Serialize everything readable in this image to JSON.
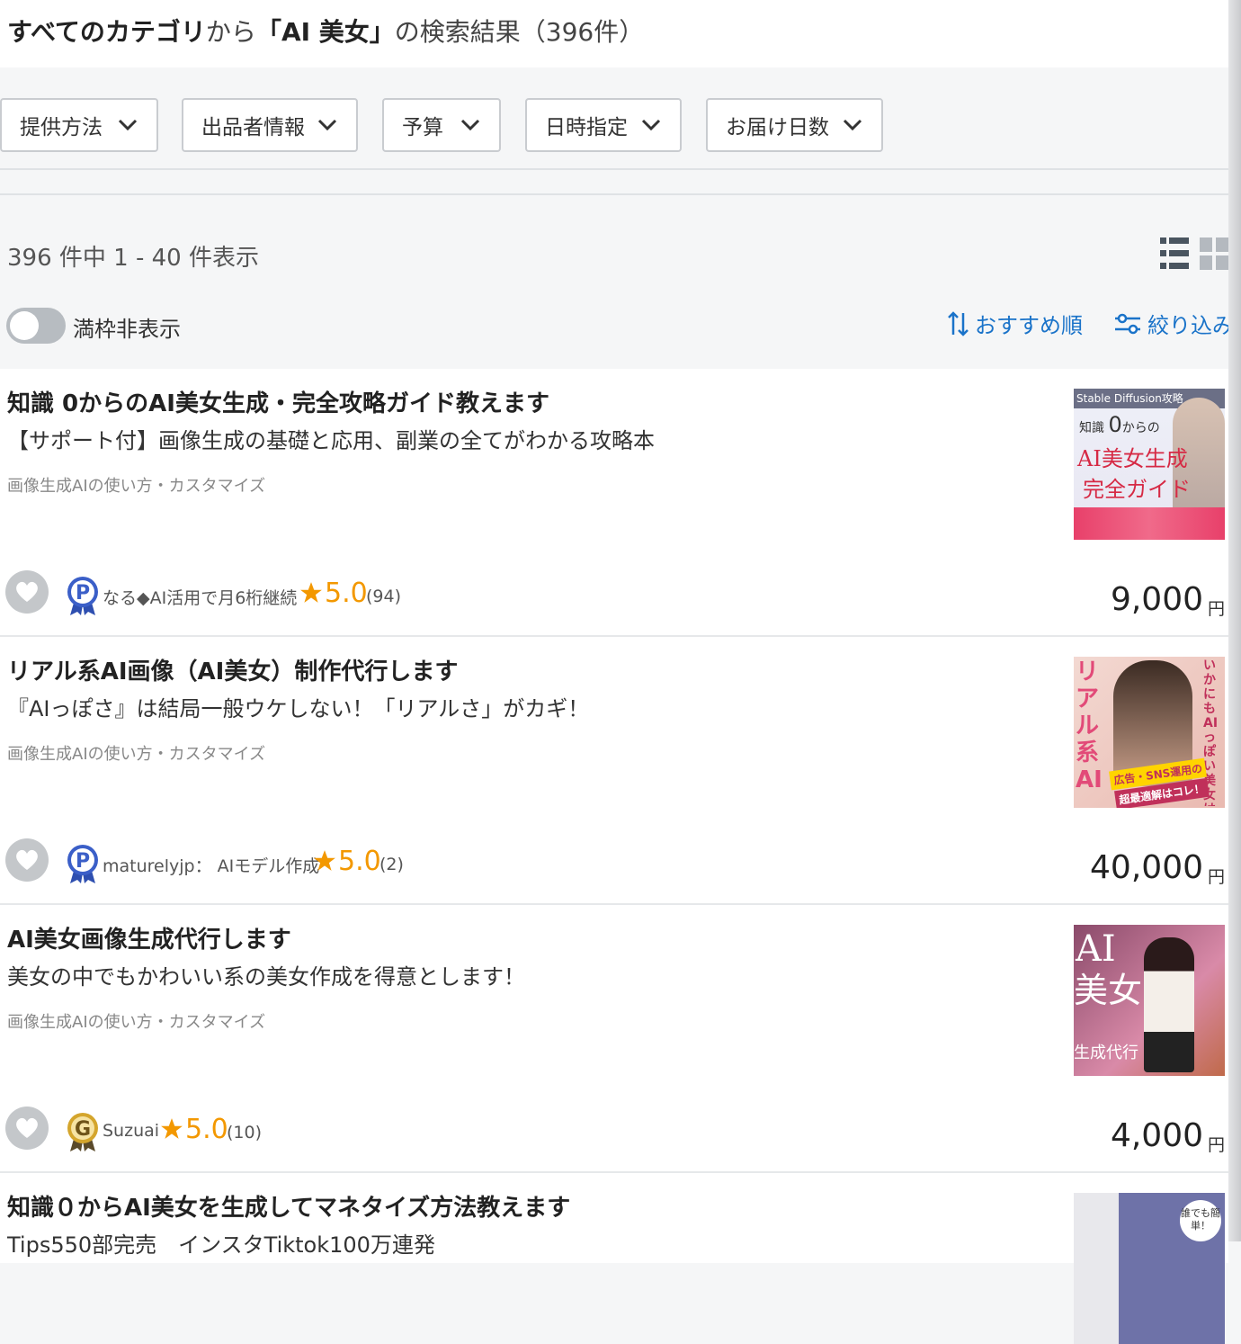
{
  "header": {
    "category": "すべてのカテゴリ",
    "from": "から",
    "query": "「AI 美女」",
    "suffix": "の検索結果",
    "count": "（396件）"
  },
  "filters": [
    {
      "label": "提供方法"
    },
    {
      "label": "出品者情報"
    },
    {
      "label": "予算"
    },
    {
      "label": "日時指定"
    },
    {
      "label": "お届け日数"
    }
  ],
  "results_summary": "396 件中 1 - 40 件表示",
  "toggle": {
    "label": "満枠非表示",
    "on": false
  },
  "sort": {
    "label": "おすすめ順"
  },
  "filter_link": {
    "label": "絞り込み"
  },
  "accent_color": "#1a73c9",
  "rating_color": "#f39800",
  "listings": [
    {
      "title": "知識 0からのAI美女生成・完全攻略ガイド教えます",
      "subtitle": "【サポート付】画像生成の基礎と応用、副業の全てがわかる攻略本",
      "category": "画像生成AIの使い方・カスタマイズ",
      "badge": "P",
      "seller": "なる◆AI活用で月6桁継続",
      "rating": "5.0",
      "reviews": "(94)",
      "price": "9,000",
      "currency": "円",
      "thumb": {
        "top": "Stable Diffusion攻略",
        "line1": "知識",
        "line1b": "0",
        "line1c": "からの",
        "line2": "AI美女生成",
        "line3": "完全ガイド"
      }
    },
    {
      "title": "リアル系AI画像（AI美女）制作代行します",
      "subtitle": "『AIっぽさ』は結局一般ウケしない！「リアルさ」がカギ！",
      "category": "画像生成AIの使い方・カスタマイズ",
      "badge": "P",
      "seller": "maturelyjp： AIモデル作成",
      "rating": "5.0",
      "reviews": "(2)",
      "price": "40,000",
      "currency": "円",
      "thumb": {
        "left": "リアル系AI",
        "right": "いかにもAIっぽい美女は一般ウケしない時代！！",
        "banner1": "広告・SNS運用の",
        "banner2": "超最適解はコレ！"
      }
    },
    {
      "title": "AI美女画像生成代行します",
      "subtitle": "美女の中でもかわいい系の美女作成を得意とします！",
      "category": "画像生成AIの使い方・カスタマイズ",
      "badge": "G",
      "seller": "Suzuai",
      "rating": "5.0",
      "reviews": "(10)",
      "price": "4,000",
      "currency": "円",
      "thumb": {
        "line1": "AI",
        "line2": "美女",
        "line3": "生成代行"
      }
    },
    {
      "title": "知識０からAI美女を生成してマネタイズ方法教えます",
      "subtitle": "Tips550部完売　インスタTiktok100万連発",
      "thumb": {
        "bubble": "誰でも簡単！"
      }
    }
  ]
}
